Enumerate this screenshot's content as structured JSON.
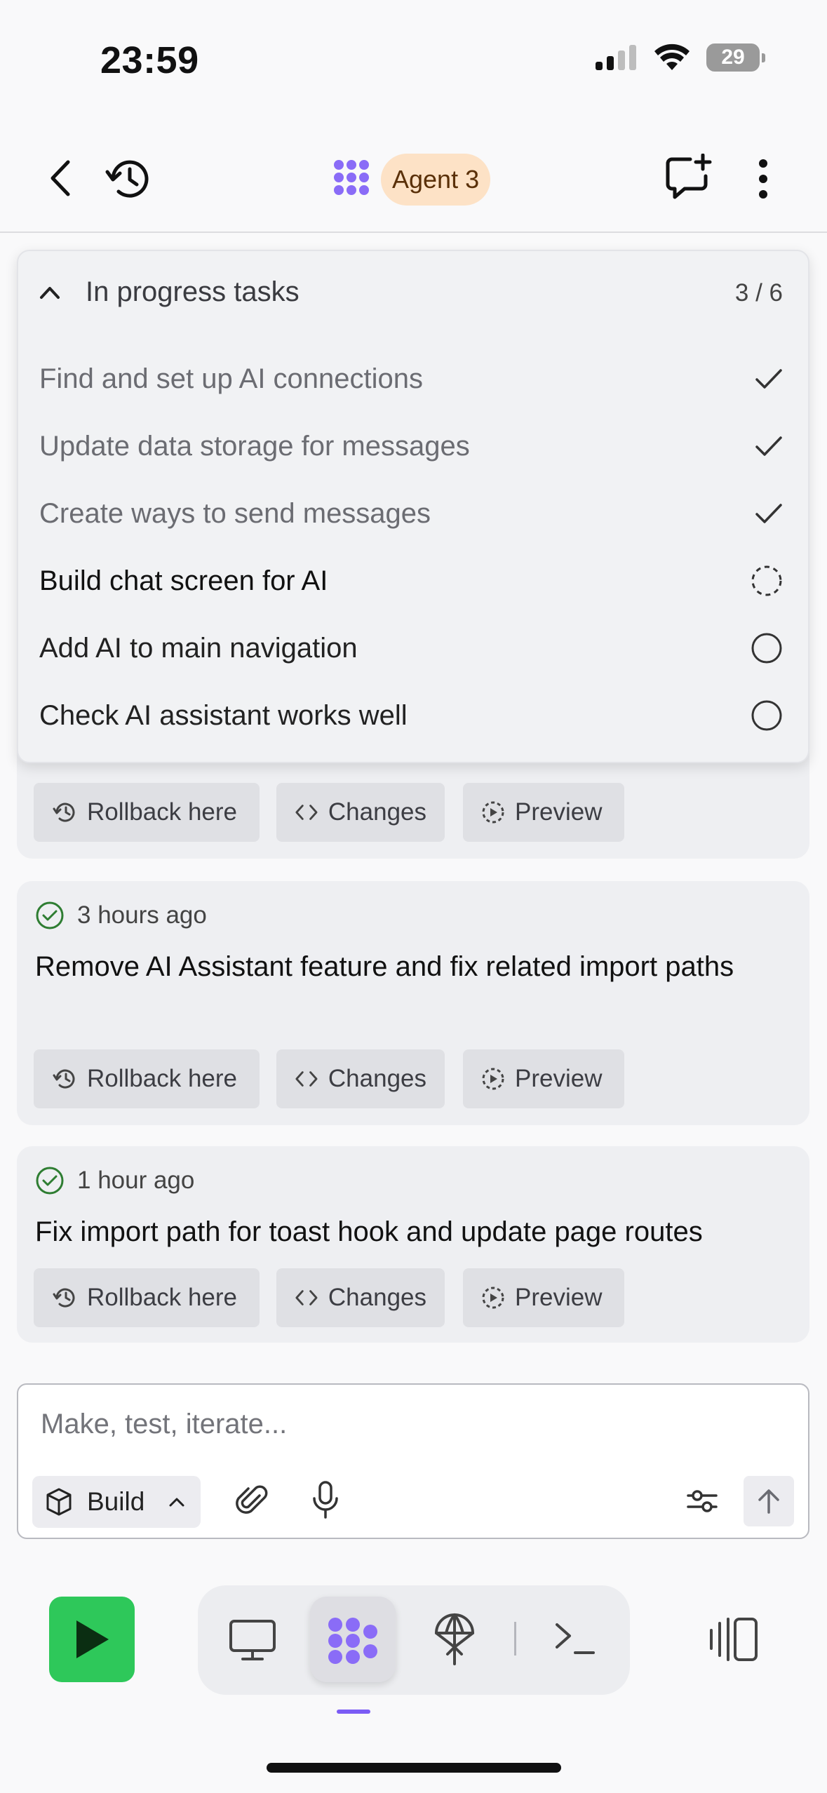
{
  "status_bar": {
    "time": "23:59",
    "battery": "29"
  },
  "header": {
    "agent_label": "Agent 3"
  },
  "tasks_panel": {
    "title": "In progress tasks",
    "count": "3 / 6",
    "items": [
      {
        "label": "Find and set up AI connections",
        "state": "done"
      },
      {
        "label": "Update data storage for messages",
        "state": "done"
      },
      {
        "label": "Create ways to send messages",
        "state": "done"
      },
      {
        "label": "Build chat screen for AI",
        "state": "in-progress"
      },
      {
        "label": "Add AI to main navigation",
        "state": "pending"
      },
      {
        "label": "Check AI assistant works well",
        "state": "pending"
      }
    ]
  },
  "actions": {
    "rollback": "Rollback here",
    "changes": "Changes",
    "preview": "Preview"
  },
  "checkpoints": [
    {
      "time": "3 hours ago",
      "title": "Remove AI Assistant feature and fix related import paths"
    },
    {
      "time": "1 hour ago",
      "title": "Fix import path for toast hook and update page routes"
    }
  ],
  "composer": {
    "placeholder": "Make, test, iterate...",
    "mode_label": "Build"
  },
  "colors": {
    "accent": "#7b5cf5",
    "run": "#2ec85a",
    "success": "#2e7d32",
    "agent_badge": "#fde2c6"
  }
}
